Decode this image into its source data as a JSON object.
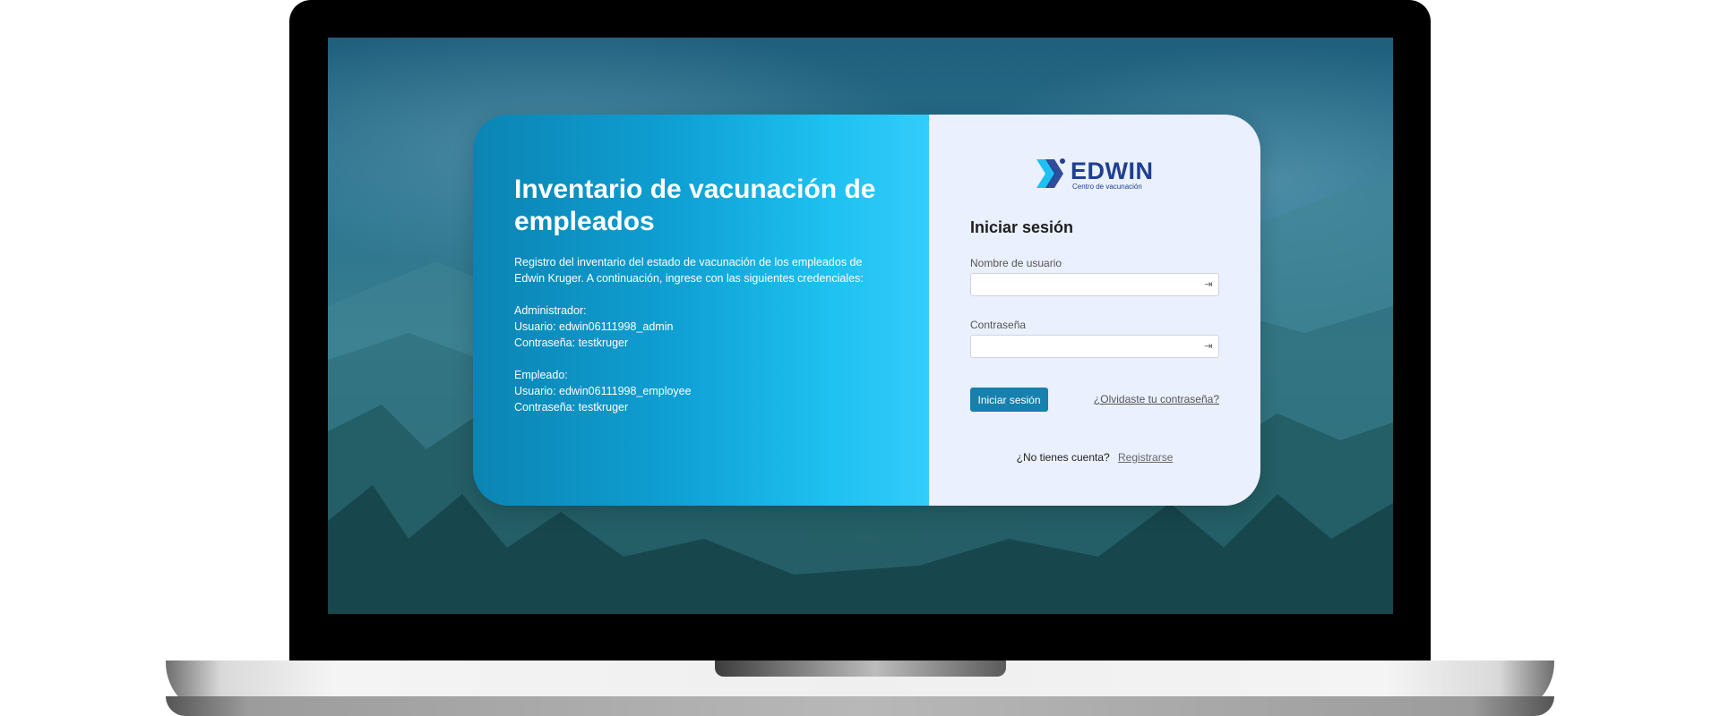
{
  "hero": {
    "title": "Inventario de vacunación de empleados",
    "description": "Registro del inventario del estado de vacunación de los empleados de Edwin Kruger. A continuación, ingrese con las siguientes credenciales:",
    "admin": {
      "heading": "Administrador:",
      "user": "Usuario: edwin06111998_admin",
      "password": "Contraseña: testkruger"
    },
    "employee": {
      "heading": "Empleado:",
      "user": "Usuario: edwin06111998_employee",
      "password": "Contraseña: testkruger"
    }
  },
  "logo": {
    "name": "EDWIN",
    "subtitle": "Centro de vacunación"
  },
  "login": {
    "title": "Iniciar sesión",
    "username_label": "Nombre de usuario",
    "username_value": "",
    "password_label": "Contraseña",
    "password_value": "",
    "submit_label": "Iniciar sesión",
    "forgot_label": "¿Olvidaste tu contraseña?",
    "no_account_text": "¿No tienes cuenta?",
    "register_label": "Registrarse"
  },
  "colors": {
    "primary_button": "#1680ae",
    "logo_blue": "#1f3f93",
    "hero_gradient_start": "#0b84b3",
    "hero_gradient_end": "#33ccfa"
  }
}
